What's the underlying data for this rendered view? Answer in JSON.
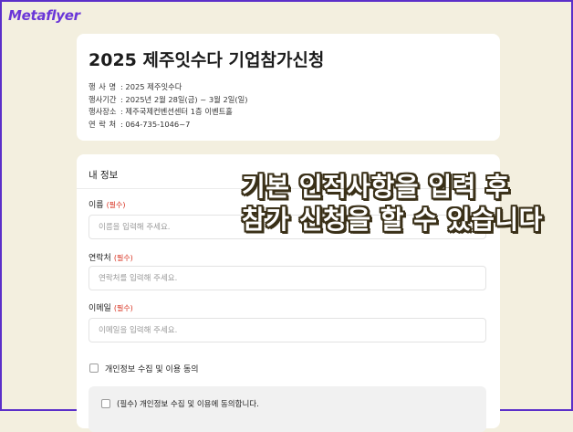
{
  "brand": {
    "logo_text": "Metaflyer",
    "accent_color": "#6a36d8"
  },
  "event": {
    "title": "2025 제주잇수다 기업참가신청",
    "info": [
      {
        "label": "행사명",
        "value": ": 2025 제주잇수다"
      },
      {
        "label": "행사기간",
        "value": ": 2025년 2월 28일(금) ~ 3월 2일(일)"
      },
      {
        "label": "행사장소",
        "value": ": 제주국제컨벤션센터 1층 이벤트홀"
      },
      {
        "label": "연락처",
        "value": ": 064-735-1046~7"
      }
    ]
  },
  "form": {
    "section_title": "내 정보",
    "required_tag": "(필수)",
    "fields": [
      {
        "label": "이름",
        "placeholder": "이름을 입력해 주세요.",
        "value": ""
      },
      {
        "label": "연락처",
        "placeholder": "연락처를 입력해 주세요.",
        "value": ""
      },
      {
        "label": "이메일",
        "placeholder": "이메일을 입력해 주세요.",
        "value": ""
      }
    ],
    "agree_all_label": "개인정보 수집 및 이용 동의",
    "agree_required_label": "(필수) 개인정보 수집 및 이용에 동의합니다."
  },
  "overlay": {
    "line1": "기본 인적사항을 입력 후",
    "line2": "참가 신청을 할 수 있습니다"
  }
}
